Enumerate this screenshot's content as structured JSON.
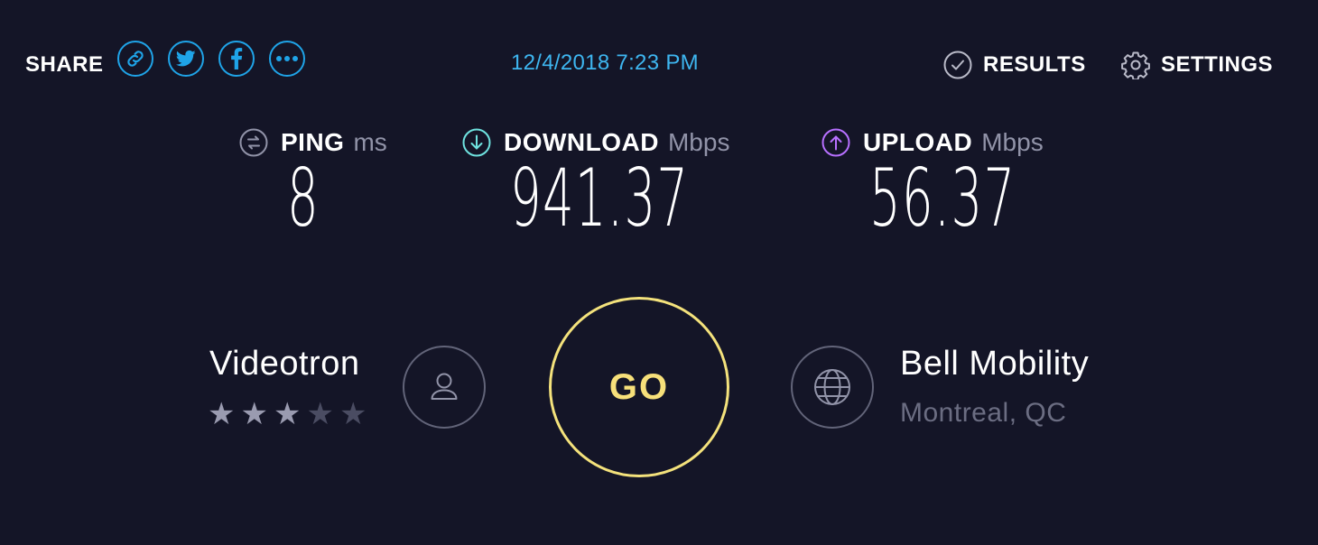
{
  "header": {
    "share_label": "SHARE",
    "share_buttons": [
      {
        "icon": "link-icon"
      },
      {
        "icon": "twitter-icon"
      },
      {
        "icon": "facebook-icon"
      },
      {
        "icon": "more-icon"
      }
    ],
    "timestamp": "12/4/2018 7:23 PM",
    "results_label": "RESULTS",
    "settings_label": "SETTINGS"
  },
  "metrics": {
    "ping": {
      "name": "PING",
      "unit": "ms",
      "value": "8"
    },
    "download": {
      "name": "DOWNLOAD",
      "unit": "Mbps",
      "value": "941.37"
    },
    "upload": {
      "name": "UPLOAD",
      "unit": "Mbps",
      "value": "56.37"
    }
  },
  "provider": {
    "name": "Videotron",
    "rating": 3,
    "rating_max": 5
  },
  "go_label": "GO",
  "server": {
    "name": "Bell Mobility",
    "location": "Montreal, QC"
  },
  "colors": {
    "background": "#141527",
    "share_blue": "#1fa4e8",
    "timestamp_blue": "#3eb6f0",
    "download_cyan": "#6fe3e0",
    "upload_purple": "#b770ff",
    "go_yellow": "#f4e27c",
    "muted_gray": "#9193a8"
  }
}
